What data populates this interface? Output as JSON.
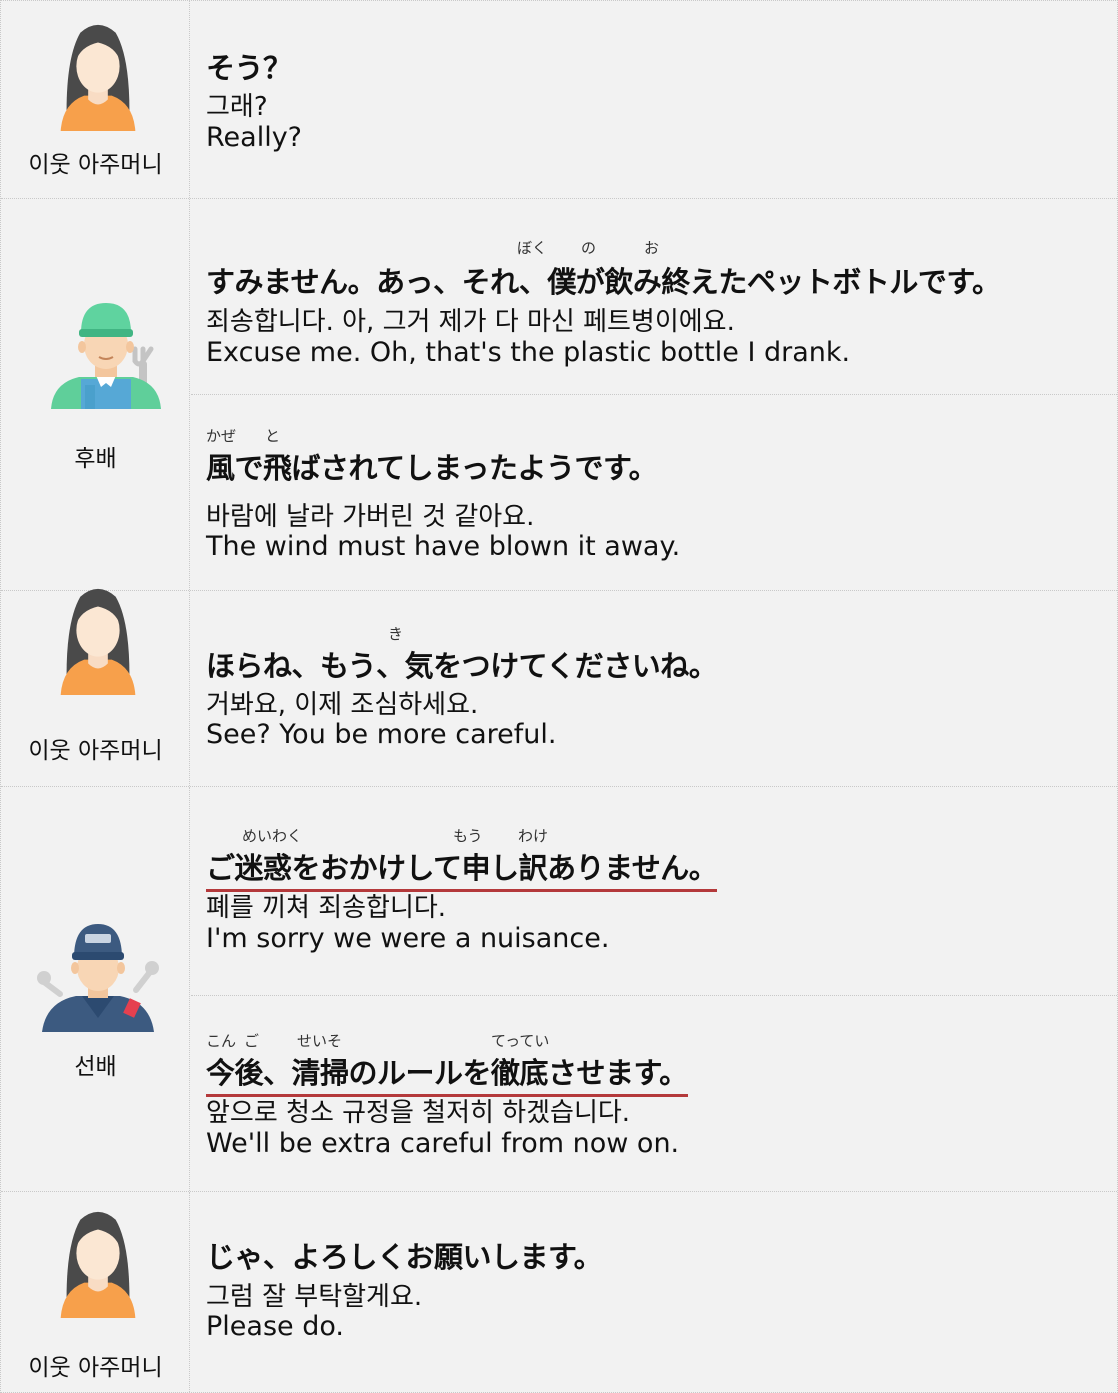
{
  "speakers": {
    "neighbor": "이웃 아주머니",
    "junior": "후배",
    "senior": "선배"
  },
  "dialogue": [
    {
      "jp": "そう？",
      "ko": "그래?",
      "en": "Really?"
    },
    {
      "ruby": [
        "ぼく",
        "の",
        "お"
      ],
      "jp": "すみません。あっ、それ、僕が飲み終えたペットボトルです。",
      "ko": "죄송합니다. 아, 그거 제가 다 마신 페트병이에요.",
      "en": "Excuse me. Oh, that's the plastic bottle I drank."
    },
    {
      "ruby": [
        "かぜ",
        "と"
      ],
      "jp": "風で飛ばされてしまったようです。",
      "ko": "바람에 날라 가버린 것 같아요.",
      "en": "The wind must have blown it away."
    },
    {
      "ruby": [
        "き"
      ],
      "jp": "ほらね、もう、気をつけてくださいね。",
      "ko": "거봐요, 이제 조심하세요.",
      "en": "See?  You be more careful."
    },
    {
      "ruby": [
        "めいわく",
        "もう",
        "わけ"
      ],
      "jp": "ご迷惑をおかけして申し訳ありません。",
      "ko": "폐를 끼쳐 죄송합니다.",
      "en": "I'm sorry we were a nuisance."
    },
    {
      "ruby": [
        "こん",
        "ご",
        "せいそ",
        "てってい"
      ],
      "jp": "今後、清掃のルールを徹底させます。",
      "ko": "앞으로 청소 규정을 철저히 하겠습니다.",
      "en": "We'll be extra careful from now on."
    },
    {
      "jp": "じゃ、よろしくお願いします。",
      "ko": "그럼 잘 부탁할게요.",
      "en": "Please do."
    }
  ],
  "colors": {
    "background": "#f2f2f2",
    "underline": "#b4393b",
    "border": "#c9c9c9"
  },
  "icons": {
    "neighbor": "woman-avatar-icon",
    "junior": "worker-green-cap-icon",
    "senior": "mechanic-blue-cap-icon"
  }
}
